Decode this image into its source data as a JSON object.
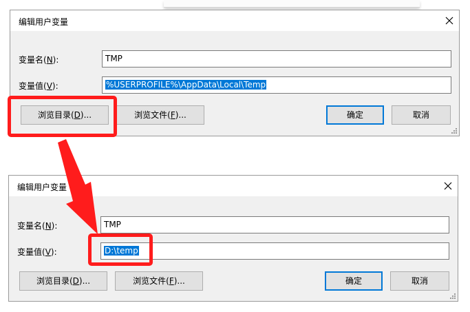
{
  "dialog1": {
    "title": "编辑用户变量",
    "name_label_pre": "变量名(",
    "name_label_key": "N",
    "name_label_post": "):",
    "name_value": "TMP",
    "value_label_pre": "变量值(",
    "value_label_key": "V",
    "value_label_post": "):",
    "value_value": "%USERPROFILE%\\AppData\\Local\\Temp",
    "browse_dir_pre": "浏览目录(",
    "browse_dir_key": "D",
    "browse_dir_post": ")...",
    "browse_file_pre": "浏览文件(",
    "browse_file_key": "F",
    "browse_file_post": ")...",
    "ok_label": "确定",
    "cancel_label": "取消"
  },
  "dialog2": {
    "title": "编辑用户变量",
    "name_label_pre": "变量名(",
    "name_label_key": "N",
    "name_label_post": "):",
    "name_value": "TMP",
    "value_label_pre": "变量值(",
    "value_label_key": "V",
    "value_label_post": "):",
    "value_value": "D:\\temp",
    "browse_dir_pre": "浏览目录(",
    "browse_dir_key": "D",
    "browse_dir_post": ")...",
    "browse_file_pre": "浏览文件(",
    "browse_file_key": "F",
    "browse_file_post": ")...",
    "ok_label": "确定",
    "cancel_label": "取消"
  },
  "colors": {
    "accent": "#0078d7",
    "annotation_red": "#ff1c1c",
    "dialog_bg": "#f0f0f0"
  },
  "icons": [
    "close-icon",
    "resize-grip-icon",
    "annotation-arrow"
  ]
}
